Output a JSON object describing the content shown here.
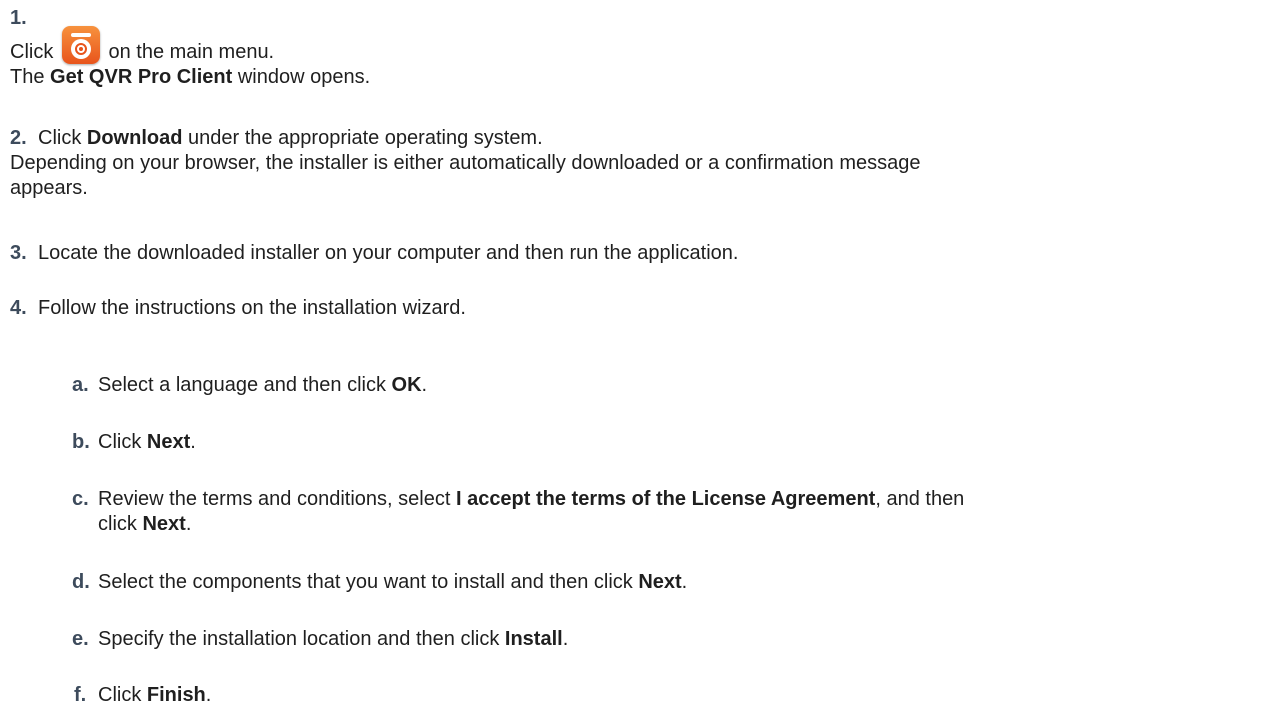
{
  "steps": [
    {
      "num": "1.",
      "click": "Click",
      "after_icon": " on the main menu.",
      "line2_pre": "The ",
      "line2_bold": "Get QVR Pro Client",
      "line2_post": " window opens."
    },
    {
      "num": "2.",
      "pre": "Click ",
      "bold": "Download",
      "post": " under the appropriate operating system.",
      "line2a": "Depending on your browser, the installer is either automatically downloaded or a confirmation message",
      "line2b": "appears."
    },
    {
      "num": "3.",
      "text": "Locate the downloaded installer on your computer and then run the application."
    },
    {
      "num": "4.",
      "text": "Follow the instructions on the installation wizard."
    }
  ],
  "substeps": [
    {
      "num": "a.",
      "pre": "Select a language and then click ",
      "bold": "OK",
      "post": "."
    },
    {
      "num": "b.",
      "pre": "Click ",
      "bold": "Next",
      "post": "."
    },
    {
      "num": "c.",
      "pre": "Review the terms and conditions, select ",
      "bold": "I accept the terms of the License Agreement",
      "post": ", and then",
      "line2_pre": "click ",
      "line2_bold": "Next",
      "line2_post": "."
    },
    {
      "num": "d.",
      "pre": "Select the components that you want to install and then click ",
      "bold": "Next",
      "post": "."
    },
    {
      "num": "e.",
      "pre": "Specify the installation location and then click ",
      "bold": "Install",
      "post": "."
    },
    {
      "num": "f.",
      "pre": "Click ",
      "bold": "Finish",
      "post": "."
    }
  ],
  "icons": {
    "app_icon": "surveillance-camera-app-icon",
    "app_icon_color": "#ef6a26"
  }
}
